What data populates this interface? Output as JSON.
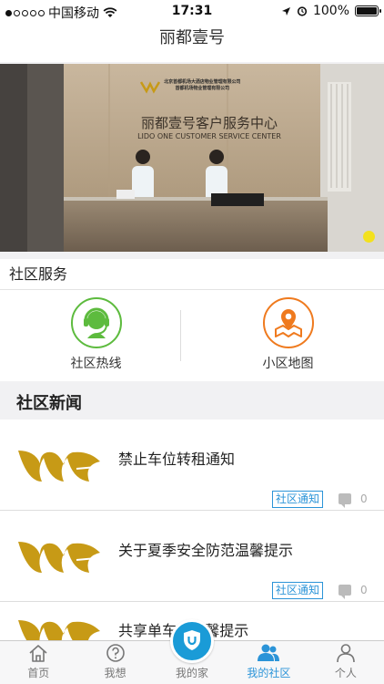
{
  "status_bar": {
    "carrier": "中国移动",
    "time": "17:31",
    "battery": "100%"
  },
  "nav": {
    "title": "丽都壹号"
  },
  "banner": {
    "sign_company_1": "北京首都机场大酒店物业管理有限公司",
    "sign_company_2": "首都机场物业管理有限公司",
    "sign_main": "丽都壹号客户服务中心",
    "sign_english": "LIDO ONE CUSTOMER SERVICE CENTER",
    "indicator_color": "#f3e11d"
  },
  "services": {
    "title": "社区服务",
    "items": [
      {
        "label": "社区热线",
        "icon": "headset-icon",
        "color": "#5dbb3e"
      },
      {
        "label": "小区地图",
        "icon": "map-pin-icon",
        "color": "#ef7a1e"
      }
    ]
  },
  "news": {
    "title": "社区新闻",
    "items": [
      {
        "title": "禁止车位转租通知",
        "tag": "社区通知",
        "comments": "0"
      },
      {
        "title": "关于夏季安全防范温馨提示",
        "tag": "社区通知",
        "comments": "0"
      },
      {
        "title": "共享单车...温馨提示",
        "tag": "",
        "comments": ""
      }
    ]
  },
  "tabs": [
    {
      "label": "首页",
      "icon": "home-icon"
    },
    {
      "label": "我想",
      "icon": "question-icon"
    },
    {
      "label": "我的家",
      "icon": "shield-u-icon"
    },
    {
      "label": "我的社区",
      "icon": "community-icon",
      "active": true
    },
    {
      "label": "个人",
      "icon": "person-icon"
    }
  ],
  "colors": {
    "accent": "#2b94d8",
    "logo_gold": "#c79a16"
  }
}
